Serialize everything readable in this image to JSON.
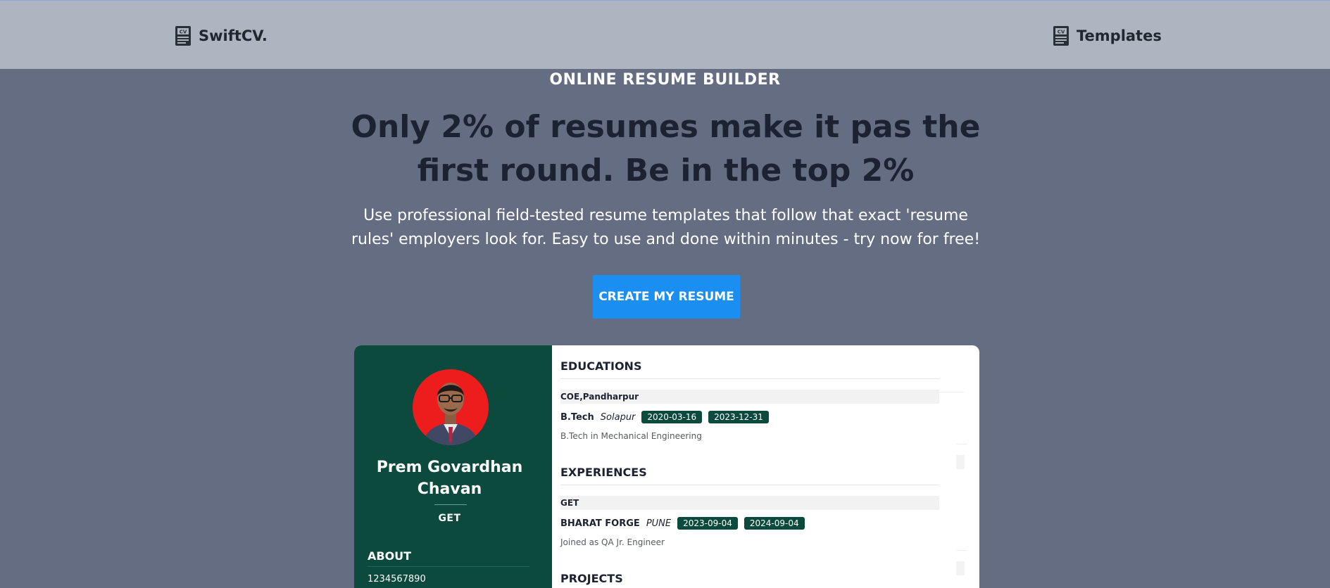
{
  "nav": {
    "brand": "SwiftCV.",
    "brand_icon": "cv-document-icon",
    "templates_label": "Templates",
    "templates_icon": "cv-document-icon"
  },
  "hero": {
    "eyebrow": "ONLINE RESUME BUILDER",
    "headline": "Only 2% of resumes make it pas the first round. Be in the top 2%",
    "subtext": "Use professional field-tested resume templates that follow that exact 'resume rules' employers look for. Easy to use and done within minutes - try now for free!",
    "cta_label": "CREATE MY RESUME"
  },
  "resume": {
    "name": "Prem Govardhan Chavan",
    "role": "GET",
    "about_heading": "ABOUT",
    "phone": "1234567890",
    "education": {
      "heading": "EDUCATIONS",
      "institution": "COE,Pandharpur",
      "degree": "B.Tech",
      "location": "Solapur",
      "start": "2020-03-16",
      "end": "2023-12-31",
      "description": "B.Tech in Mechanical Engineering"
    },
    "experience": {
      "heading": "EXPERIENCES",
      "title": "GET",
      "company": "BHARAT FORGE",
      "location": "PUNE",
      "start": "2023-09-04",
      "end": "2024-09-04",
      "description": "Joined as QA Jr. Engineer"
    },
    "projects": {
      "heading": "PROJECTS"
    }
  },
  "colors": {
    "page_bg": "#656d83",
    "nav_bg": "#adb5c0",
    "cta": "#1b8ef1",
    "sidebar": "#0b4a3c"
  }
}
